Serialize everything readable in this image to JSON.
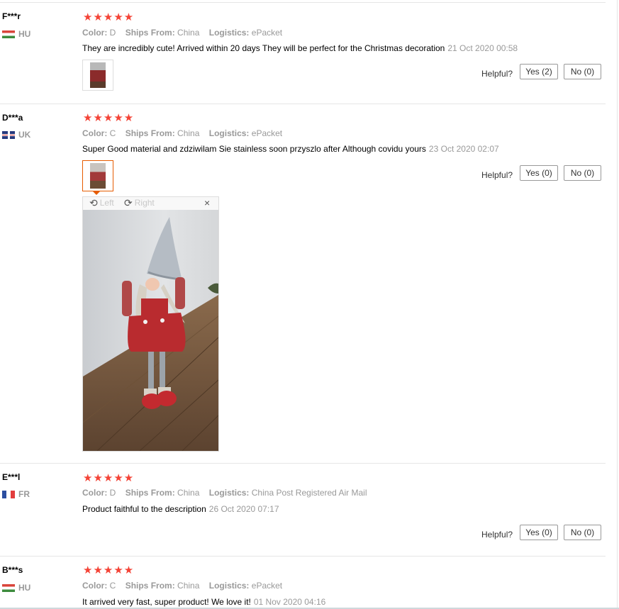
{
  "reviews": [
    {
      "user": "F***r",
      "country": "HU",
      "stars": "★★★★★",
      "color_key": "Color:",
      "color_val": "D",
      "ships_key": "Ships From:",
      "ships_val": "China",
      "logistics_key": "Logistics:",
      "logistics_val": "ePacket",
      "text": "They are incredibly cute! Arrived within 20 days They will be perfect for the Christmas decoration",
      "date": "21 Oct 2020 00:58",
      "helpful_label": "Helpful?",
      "yes_label": "Yes (2)",
      "no_label": "No (0)"
    },
    {
      "user": "D***a",
      "country": "UK",
      "stars": "★★★★★",
      "color_key": "Color:",
      "color_val": "C",
      "ships_key": "Ships From:",
      "ships_val": "China",
      "logistics_key": "Logistics:",
      "logistics_val": "ePacket",
      "text": "Super Good material and zdziwilam Sie stainless soon przyszlo after Although covidu yours",
      "date": "23 Oct 2020 02:07",
      "helpful_label": "Helpful?",
      "yes_label": "Yes (0)",
      "no_label": "No (0)"
    },
    {
      "user": "E***l",
      "country": "FR",
      "stars": "★★★★★",
      "color_key": "Color:",
      "color_val": "D",
      "ships_key": "Ships From:",
      "ships_val": "China",
      "logistics_key": "Logistics:",
      "logistics_val": "China Post Registered Air Mail",
      "text": "Product faithful to the description",
      "date": "26 Oct 2020 07:17",
      "helpful_label": "Helpful?",
      "yes_label": "Yes (0)",
      "no_label": "No (0)"
    },
    {
      "user": "B***s",
      "country": "HU",
      "stars": "★★★★★",
      "color_key": "Color:",
      "color_val": "C",
      "ships_key": "Ships From:",
      "ships_val": "China",
      "logistics_key": "Logistics:",
      "logistics_val": "ePacket",
      "text": "It arrived very fast, super product! We love it!",
      "date": "01 Nov 2020 04:16"
    }
  ],
  "viewer": {
    "rotate_left": "Left",
    "rotate_right": "Right",
    "close": "×"
  },
  "colors": {
    "star": "#f44336",
    "active_thumb": "#e65c00"
  }
}
